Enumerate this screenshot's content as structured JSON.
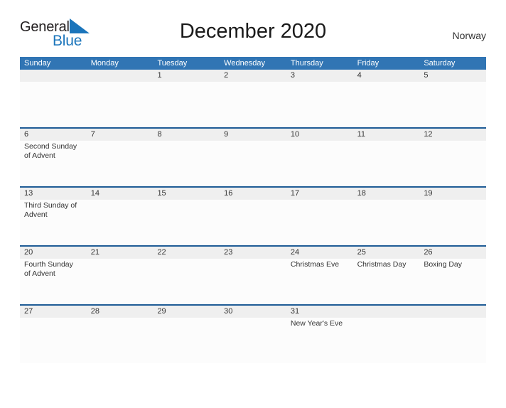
{
  "brand": {
    "text_general": "General",
    "text_blue": "Blue",
    "flag_color": "#1b75bb"
  },
  "header": {
    "title": "December 2020",
    "country": "Norway"
  },
  "theme": {
    "header_blue": "#3175b4",
    "week_rule_blue": "#1f5c96",
    "date_band_gray": "#efefef",
    "text_color": "#333333"
  },
  "calendar": {
    "weekdays": [
      "Sunday",
      "Monday",
      "Tuesday",
      "Wednesday",
      "Thursday",
      "Friday",
      "Saturday"
    ],
    "weeks": [
      {
        "days": [
          {
            "num": "",
            "events": []
          },
          {
            "num": "",
            "events": []
          },
          {
            "num": "1",
            "events": []
          },
          {
            "num": "2",
            "events": []
          },
          {
            "num": "3",
            "events": []
          },
          {
            "num": "4",
            "events": []
          },
          {
            "num": "5",
            "events": []
          }
        ]
      },
      {
        "days": [
          {
            "num": "6",
            "events": [
              "Second Sunday of Advent"
            ]
          },
          {
            "num": "7",
            "events": []
          },
          {
            "num": "8",
            "events": []
          },
          {
            "num": "9",
            "events": []
          },
          {
            "num": "10",
            "events": []
          },
          {
            "num": "11",
            "events": []
          },
          {
            "num": "12",
            "events": []
          }
        ]
      },
      {
        "days": [
          {
            "num": "13",
            "events": [
              "Third Sunday of Advent"
            ]
          },
          {
            "num": "14",
            "events": []
          },
          {
            "num": "15",
            "events": []
          },
          {
            "num": "16",
            "events": []
          },
          {
            "num": "17",
            "events": []
          },
          {
            "num": "18",
            "events": []
          },
          {
            "num": "19",
            "events": []
          }
        ]
      },
      {
        "days": [
          {
            "num": "20",
            "events": [
              "Fourth Sunday of Advent"
            ]
          },
          {
            "num": "21",
            "events": []
          },
          {
            "num": "22",
            "events": []
          },
          {
            "num": "23",
            "events": []
          },
          {
            "num": "24",
            "events": [
              "Christmas Eve"
            ]
          },
          {
            "num": "25",
            "events": [
              "Christmas Day"
            ]
          },
          {
            "num": "26",
            "events": [
              "Boxing Day"
            ]
          }
        ]
      },
      {
        "days": [
          {
            "num": "27",
            "events": []
          },
          {
            "num": "28",
            "events": []
          },
          {
            "num": "29",
            "events": []
          },
          {
            "num": "30",
            "events": []
          },
          {
            "num": "31",
            "events": [
              "New Year's Eve"
            ]
          },
          {
            "num": "",
            "events": []
          },
          {
            "num": "",
            "events": []
          }
        ]
      }
    ]
  }
}
